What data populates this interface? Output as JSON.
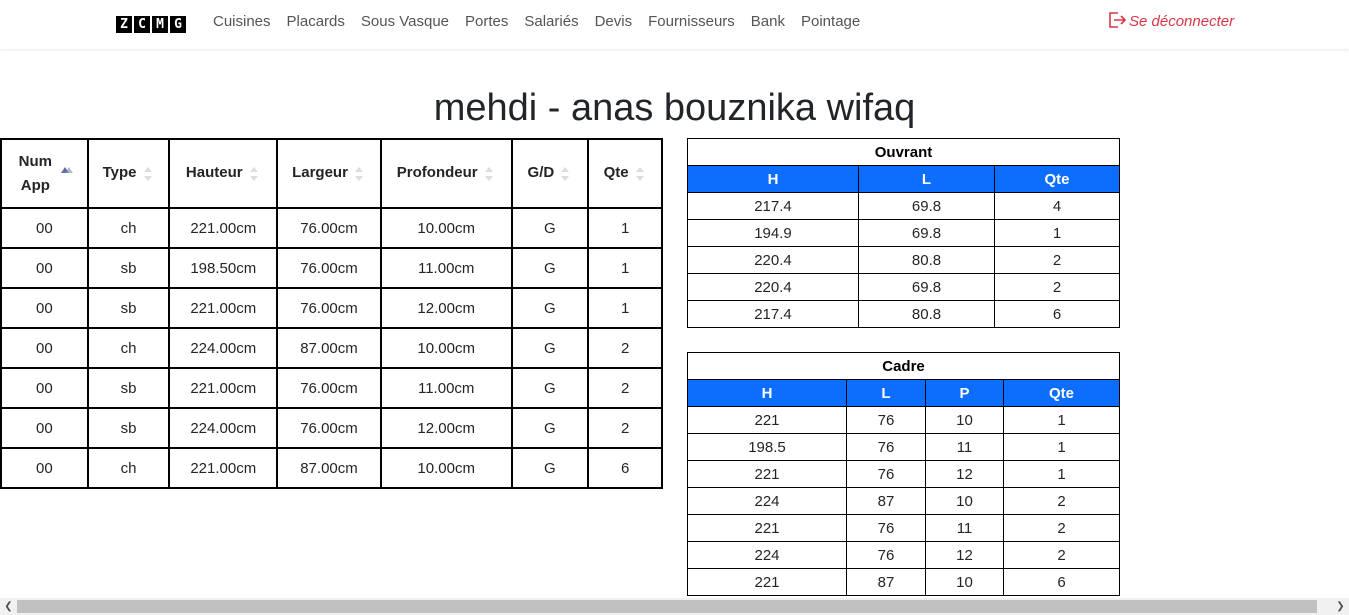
{
  "nav": {
    "brand_letters": [
      "Z",
      "C",
      "M",
      "G"
    ],
    "items": [
      "Cuisines",
      "Placards",
      "Sous Vasque",
      "Portes",
      "Salariés",
      "Devis",
      "Fournisseurs",
      "Bank",
      "Pointage"
    ],
    "logout_label": "Se déconnecter"
  },
  "page": {
    "title": "mehdi - anas bouznika wifaq"
  },
  "main_table": {
    "columns": [
      "Num App",
      "Type",
      "Hauteur",
      "Largeur",
      "Profondeur",
      "G/D",
      "Qte"
    ],
    "rows": [
      [
        "00",
        "ch",
        "221.00cm",
        "76.00cm",
        "10.00cm",
        "G",
        "1"
      ],
      [
        "00",
        "sb",
        "198.50cm",
        "76.00cm",
        "11.00cm",
        "G",
        "1"
      ],
      [
        "00",
        "sb",
        "221.00cm",
        "76.00cm",
        "12.00cm",
        "G",
        "1"
      ],
      [
        "00",
        "ch",
        "224.00cm",
        "87.00cm",
        "10.00cm",
        "G",
        "2"
      ],
      [
        "00",
        "sb",
        "221.00cm",
        "76.00cm",
        "11.00cm",
        "G",
        "2"
      ],
      [
        "00",
        "sb",
        "224.00cm",
        "76.00cm",
        "12.00cm",
        "G",
        "2"
      ],
      [
        "00",
        "ch",
        "221.00cm",
        "87.00cm",
        "10.00cm",
        "G",
        "6"
      ]
    ]
  },
  "ouvrant": {
    "caption": "Ouvrant",
    "columns": [
      "H",
      "L",
      "Qte"
    ],
    "rows": [
      [
        "217.4",
        "69.8",
        "4"
      ],
      [
        "194.9",
        "69.8",
        "1"
      ],
      [
        "220.4",
        "80.8",
        "2"
      ],
      [
        "220.4",
        "69.8",
        "2"
      ],
      [
        "217.4",
        "80.8",
        "6"
      ]
    ]
  },
  "cadre": {
    "caption": "Cadre",
    "columns": [
      "H",
      "L",
      "P",
      "Qte"
    ],
    "rows": [
      [
        "221",
        "76",
        "10",
        "1"
      ],
      [
        "198.5",
        "76",
        "11",
        "1"
      ],
      [
        "221",
        "76",
        "12",
        "1"
      ],
      [
        "224",
        "87",
        "10",
        "2"
      ],
      [
        "221",
        "76",
        "11",
        "2"
      ],
      [
        "224",
        "76",
        "12",
        "2"
      ],
      [
        "221",
        "87",
        "10",
        "6"
      ]
    ]
  },
  "colors": {
    "accent": "#0d6efd",
    "danger": "#dc3545"
  }
}
